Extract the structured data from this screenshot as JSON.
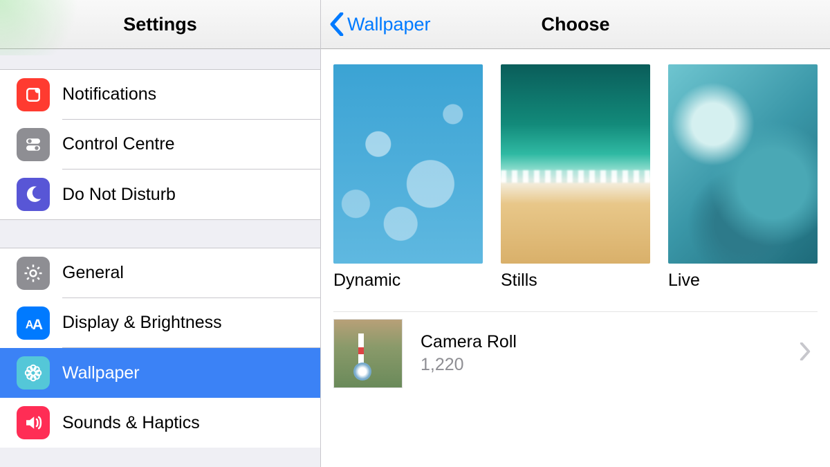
{
  "sidebar": {
    "title": "Settings",
    "items": [
      {
        "label": "Notifications"
      },
      {
        "label": "Control Centre"
      },
      {
        "label": "Do Not Disturb"
      },
      {
        "label": "General"
      },
      {
        "label": "Display & Brightness"
      },
      {
        "label": "Wallpaper"
      },
      {
        "label": "Sounds & Haptics"
      }
    ]
  },
  "detail": {
    "back_label": "Wallpaper",
    "title": "Choose",
    "categories": [
      {
        "label": "Dynamic"
      },
      {
        "label": "Stills"
      },
      {
        "label": "Live"
      }
    ],
    "albums": [
      {
        "title": "Camera Roll",
        "count": "1,220"
      }
    ]
  }
}
